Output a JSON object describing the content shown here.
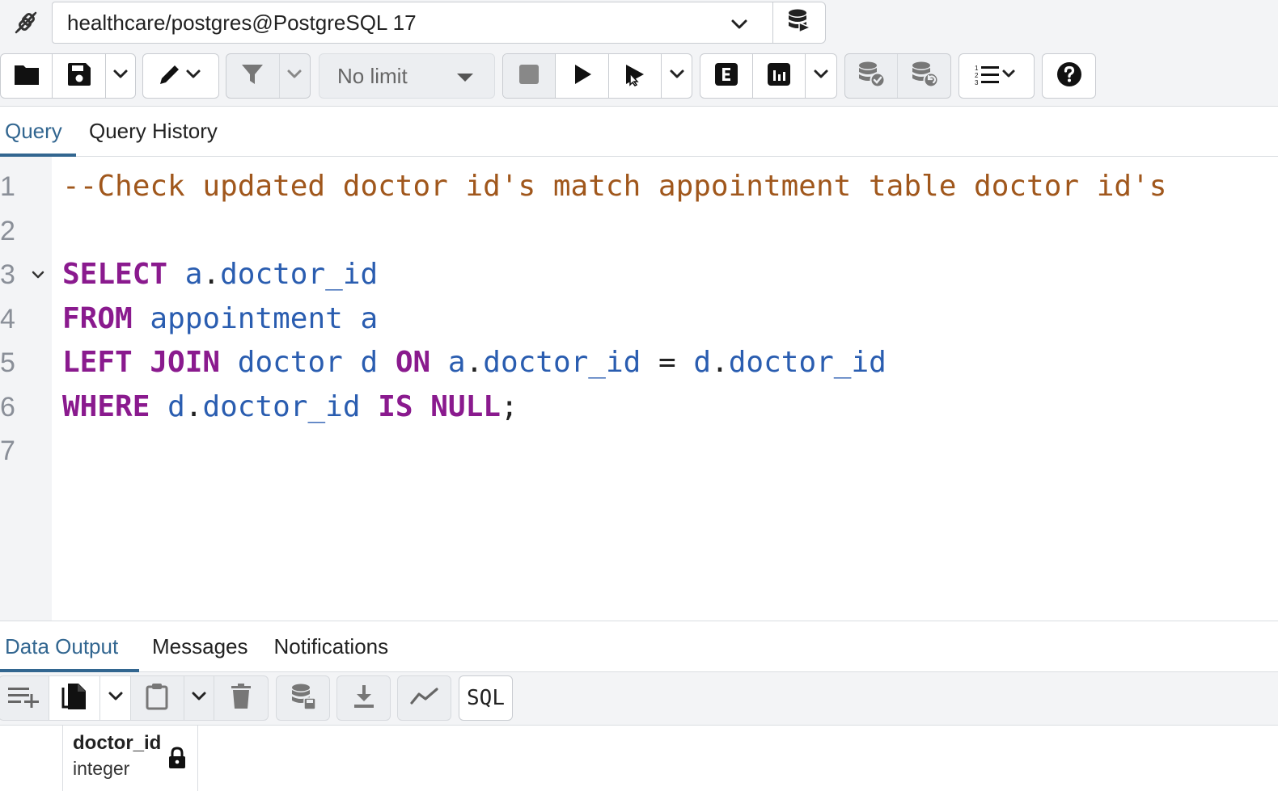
{
  "connection": {
    "value": "healthcare/postgres@PostgreSQL 17",
    "icons": [
      "disconnect-plug-icon",
      "chevron-down-icon",
      "database-icon"
    ]
  },
  "toolbar": {
    "limit_value": "No limit",
    "icons": [
      "folder-icon",
      "save-icon",
      "pencil-icon",
      "filter-icon",
      "stop-icon",
      "play-icon",
      "play-cursor-icon",
      "explain-icon",
      "explain-analyze-icon",
      "commit-icon",
      "rollback-icon",
      "macros-icon",
      "help-icon"
    ]
  },
  "query_tabs": {
    "items": [
      {
        "label": "Query",
        "active": true
      },
      {
        "label": "Query History",
        "active": false
      }
    ]
  },
  "editor": {
    "line_numbers": [
      "1",
      "2",
      "3",
      "4",
      "5",
      "6",
      "7"
    ],
    "lines": [
      [
        {
          "t": "--Check updated doctor id's match appointment table doctor id's",
          "c": "cm"
        }
      ],
      [],
      [
        {
          "t": "SELECT",
          "c": "kw"
        },
        {
          "t": " ",
          "c": "pn"
        },
        {
          "t": "a",
          "c": "id"
        },
        {
          "t": ".",
          "c": "pn"
        },
        {
          "t": "doctor_id",
          "c": "id"
        }
      ],
      [
        {
          "t": "FROM",
          "c": "kw"
        },
        {
          "t": " ",
          "c": "pn"
        },
        {
          "t": "appointment a",
          "c": "id"
        }
      ],
      [
        {
          "t": "LEFT JOIN",
          "c": "kw"
        },
        {
          "t": " ",
          "c": "pn"
        },
        {
          "t": "doctor d",
          "c": "id"
        },
        {
          "t": " ",
          "c": "pn"
        },
        {
          "t": "ON",
          "c": "kw"
        },
        {
          "t": " ",
          "c": "pn"
        },
        {
          "t": "a",
          "c": "id"
        },
        {
          "t": ".",
          "c": "pn"
        },
        {
          "t": "doctor_id",
          "c": "id"
        },
        {
          "t": " = ",
          "c": "pn"
        },
        {
          "t": "d",
          "c": "id"
        },
        {
          "t": ".",
          "c": "pn"
        },
        {
          "t": "doctor_id",
          "c": "id"
        }
      ],
      [
        {
          "t": "WHERE",
          "c": "kw"
        },
        {
          "t": " ",
          "c": "pn"
        },
        {
          "t": "d",
          "c": "id"
        },
        {
          "t": ".",
          "c": "pn"
        },
        {
          "t": "doctor_id",
          "c": "id"
        },
        {
          "t": " ",
          "c": "pn"
        },
        {
          "t": "IS NULL",
          "c": "kw"
        },
        {
          "t": ";",
          "c": "pn"
        }
      ],
      []
    ]
  },
  "output_tabs": {
    "items": [
      {
        "label": "Data Output",
        "active": true
      },
      {
        "label": "Messages",
        "active": false
      },
      {
        "label": "Notifications",
        "active": false
      }
    ]
  },
  "output_toolbar": {
    "sql_label": "SQL",
    "icons": [
      "add-row-icon",
      "copy-icon",
      "paste-icon",
      "delete-icon",
      "save-data-icon",
      "download-icon",
      "graph-icon"
    ]
  },
  "result_grid": {
    "columns": [
      {
        "name": "doctor_id",
        "type": "integer",
        "locked": true
      }
    ]
  },
  "colors": {
    "accent": "#326690",
    "keyword": "#8a1a8e",
    "identifier": "#2a5db0",
    "comment": "#a0571c"
  }
}
